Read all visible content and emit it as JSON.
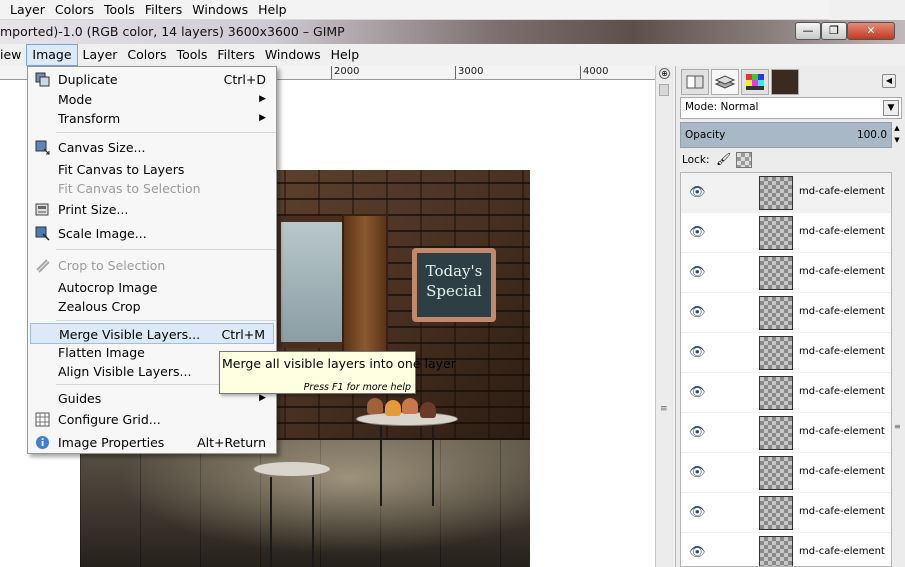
{
  "app_menubar_top": [
    "Layer",
    "Colors",
    "Tools",
    "Filters",
    "Windows",
    "Help"
  ],
  "window": {
    "title": "mported)-1.0 (RGB color, 14 layers) 3600x3600 – GIMP",
    "min_glyph": "—",
    "max_glyph": "❐",
    "close_glyph": "✕"
  },
  "image_menubar": [
    "iew",
    "Image",
    "Layer",
    "Colors",
    "Tools",
    "Filters",
    "Windows",
    "Help"
  ],
  "ruler": {
    "labels": [
      "2000",
      "3000",
      "4000"
    ]
  },
  "canvas": {
    "chalkboard_line1": "Today's",
    "chalkboard_line2": "Special",
    "zoom_glyph": "⊕"
  },
  "image_menu": {
    "items": [
      {
        "label": "Duplicate",
        "shortcut": "Ctrl+D",
        "icon": "duplicate-icon",
        "disabled": false
      },
      {
        "label": "Mode",
        "shortcut": "",
        "submenu": true,
        "disabled": false
      },
      {
        "label": "Transform",
        "shortcut": "",
        "submenu": true,
        "disabled": false
      },
      {
        "label": "Canvas Size...",
        "shortcut": "",
        "icon": "canvas-size-icon",
        "disabled": false
      },
      {
        "label": "Fit Canvas to Layers",
        "shortcut": "",
        "disabled": false
      },
      {
        "label": "Fit Canvas to Selection",
        "shortcut": "",
        "disabled": true
      },
      {
        "label": "Print Size...",
        "shortcut": "",
        "icon": "print-size-icon",
        "disabled": false
      },
      {
        "label": "Scale Image...",
        "shortcut": "",
        "icon": "scale-image-icon",
        "disabled": false
      },
      {
        "label": "Crop to Selection",
        "shortcut": "",
        "icon": "crop-icon",
        "disabled": true
      },
      {
        "label": "Autocrop Image",
        "shortcut": "",
        "disabled": false
      },
      {
        "label": "Zealous Crop",
        "shortcut": "",
        "disabled": false
      },
      {
        "label": "Merge Visible Layers...",
        "shortcut": "Ctrl+M",
        "disabled": false,
        "highlighted": true
      },
      {
        "label": "Flatten Image",
        "shortcut": "",
        "disabled": false
      },
      {
        "label": "Align Visible Layers...",
        "shortcut": "",
        "disabled": false
      },
      {
        "label": "Guides",
        "shortcut": "",
        "submenu": true,
        "disabled": false
      },
      {
        "label": "Configure Grid...",
        "shortcut": "",
        "icon": "grid-icon",
        "disabled": false
      },
      {
        "label": "Image Properties",
        "shortcut": "Alt+Return",
        "icon": "info-icon",
        "disabled": false
      }
    ]
  },
  "tooltip": {
    "text": "Merge all visible layers into one layer",
    "hint": "Press F1 for more help"
  },
  "layers_dock": {
    "mode_label": "Mode: Normal",
    "opacity_label": "Opacity",
    "opacity_value": "100.0",
    "lock_label": "Lock:",
    "layers": [
      {
        "name": "md-cafe-element"
      },
      {
        "name": "md-cafe-element"
      },
      {
        "name": "md-cafe-element"
      },
      {
        "name": "md-cafe-element"
      },
      {
        "name": "md-cafe-element"
      },
      {
        "name": "md-cafe-element"
      },
      {
        "name": "md-cafe-element"
      },
      {
        "name": "md-cafe-element"
      },
      {
        "name": "md-cafe-element"
      },
      {
        "name": "md-cafe-element"
      }
    ]
  }
}
